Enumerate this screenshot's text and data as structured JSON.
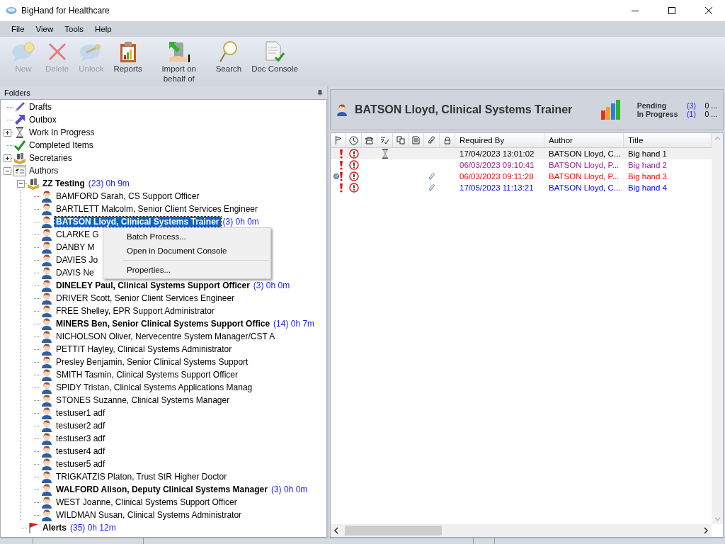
{
  "window": {
    "title": "BigHand for Healthcare"
  },
  "menu": [
    "File",
    "View",
    "Tools",
    "Help"
  ],
  "toolbar": [
    {
      "kind": "new",
      "label": "New",
      "disabled": true
    },
    {
      "kind": "delete",
      "label": "Delete",
      "disabled": true
    },
    {
      "kind": "unlock",
      "label": "Unlock",
      "disabled": true
    },
    {
      "kind": "reports",
      "label": "Reports",
      "disabled": false
    },
    {
      "kind": "import",
      "label": "Import on behalf of",
      "disabled": false
    },
    {
      "kind": "search",
      "label": "Search",
      "disabled": false
    },
    {
      "kind": "console",
      "label": "Doc Console",
      "disabled": false
    }
  ],
  "folders": {
    "title": "Folders",
    "tree": [
      {
        "kind": "pencil",
        "label": "Drafts",
        "selected": false
      },
      {
        "kind": "outbox",
        "label": "Outbox",
        "selected": false
      },
      {
        "kind": "hourglass",
        "label": "Work In Progress",
        "expanded": false,
        "selected": false
      },
      {
        "kind": "check",
        "label": "Completed Items",
        "selected": false
      },
      {
        "kind": "group",
        "label": "Secretaries",
        "expanded": false,
        "selected": false
      },
      {
        "kind": "list",
        "label": "Authors",
        "expanded": true,
        "selected": false,
        "children": [
          {
            "kind": "group",
            "label": "ZZ Testing",
            "bold": true,
            "count": "(23) 0h 9m",
            "expanded": true,
            "selected": false,
            "children": [
              {
                "kind": "person",
                "label": "BAMFORD Sarah, CS Support Officer",
                "bold": false,
                "selected": false
              },
              {
                "kind": "person",
                "label": "BARTLETT Malcolm, Senior Client Services Engineer",
                "bold": false,
                "selected": false
              },
              {
                "kind": "person",
                "label": "BATSON Lloyd, Clinical Systems Trainer",
                "bold": true,
                "count": "(3) 0h 0m",
                "selected": true
              },
              {
                "kind": "person",
                "label": "CLARKE G",
                "bold": false,
                "selected": false
              },
              {
                "kind": "person",
                "label": "DANBY M",
                "bold": false,
                "selected": false
              },
              {
                "kind": "person",
                "label": "DAVIES Jo",
                "bold": false,
                "selected": false
              },
              {
                "kind": "person",
                "label": "DAVIS Ne",
                "bold": false,
                "selected": false
              },
              {
                "kind": "person",
                "label": "DINELEY Paul, Clinical Systems Support Officer",
                "bold": true,
                "count": "(3) 0h 0m",
                "selected": false
              },
              {
                "kind": "person",
                "label": "DRIVER Scott, Senior Client Services Engineer",
                "bold": false,
                "selected": false
              },
              {
                "kind": "person",
                "label": "FREE Shelley, EPR Support Administrator",
                "bold": false,
                "selected": false
              },
              {
                "kind": "person",
                "label": "MINERS Ben, Senior Clinical Systems Support Office",
                "bold": true,
                "count": "(14) 0h 7m",
                "selected": false
              },
              {
                "kind": "person",
                "label": "NICHOLSON Oliver, Nervecentre System Manager/CST A",
                "bold": false,
                "selected": false
              },
              {
                "kind": "person",
                "label": "PETTIT Hayley, Clinical Systems Administrator",
                "bold": false,
                "selected": false
              },
              {
                "kind": "person",
                "label": "Presley Benjamin, Senior Clinical Systems Support",
                "bold": false,
                "selected": false
              },
              {
                "kind": "person",
                "label": "SMITH Tasmin, Clinical Systems Support Officer",
                "bold": false,
                "selected": false
              },
              {
                "kind": "person",
                "label": "SPIDY Tristan, Clinical Systems Applications Manag",
                "bold": false,
                "selected": false
              },
              {
                "kind": "person",
                "label": "STONES Suzanne, Clinical Systems Manager",
                "bold": false,
                "selected": false
              },
              {
                "kind": "person",
                "label": "testuser1 adf",
                "bold": false,
                "selected": false
              },
              {
                "kind": "person",
                "label": "testuser2 adf",
                "bold": false,
                "selected": false
              },
              {
                "kind": "person",
                "label": "testuser3 adf",
                "bold": false,
                "selected": false
              },
              {
                "kind": "person",
                "label": "testuser4 adf",
                "bold": false,
                "selected": false
              },
              {
                "kind": "person",
                "label": "testuser5 adf",
                "bold": false,
                "selected": false
              },
              {
                "kind": "person",
                "label": "TRIGKATZIS Platon, Trust StR Higher Doctor",
                "bold": false,
                "selected": false
              },
              {
                "kind": "person",
                "label": "WALFORD Alison, Deputy Clinical Systems Manager",
                "bold": true,
                "count": "(3) 0h 0m",
                "selected": false
              },
              {
                "kind": "person",
                "label": "WEST Joanne, Clinical Systems Support Officer",
                "bold": false,
                "selected": false
              },
              {
                "kind": "person",
                "label": "WILDMAN Susan, Clinical Systems Administrator",
                "bold": false,
                "selected": false
              }
            ]
          },
          {
            "kind": "flag",
            "label": "Alerts",
            "bold": true,
            "count": "(35) 0h 12m",
            "selected": false
          }
        ]
      }
    ]
  },
  "context_menu": [
    {
      "kind": "item",
      "label": "Batch Process..."
    },
    {
      "kind": "item",
      "label": "Open in Document Console"
    },
    {
      "kind": "separator"
    },
    {
      "kind": "item",
      "label": "Properties..."
    }
  ],
  "author_panel": {
    "name": "BATSON Lloyd, Clinical Systems Trainer",
    "stats": [
      {
        "label": "Pending",
        "count": "(3)",
        "value": "0 ..."
      },
      {
        "label": "In Progress",
        "count": "(1)",
        "value": "0 ..."
      }
    ]
  },
  "table": {
    "columns": [
      "Required By",
      "Author",
      "Title"
    ],
    "rows": [
      {
        "selected": true,
        "color": "#000000",
        "priority": true,
        "overdue": true,
        "gauge": false,
        "hourglass": true,
        "attachment": false,
        "required_by": "17/04/2023 13:01:02",
        "author": "BATSON Lloyd, C...",
        "title": "Big hand 1"
      },
      {
        "selected": false,
        "color": "#9c1a9c",
        "priority": true,
        "overdue": true,
        "gauge": false,
        "hourglass": false,
        "attachment": false,
        "required_by": "06/03/2023 09:10:41",
        "author": "BATSON Lloyd, P...",
        "title": "Big hand 2"
      },
      {
        "selected": false,
        "color": "#ff0000",
        "priority": true,
        "overdue": true,
        "gauge": true,
        "hourglass": false,
        "attachment": true,
        "required_by": "06/03/2023 09:11:28",
        "author": "BATSON Lloyd, P...",
        "title": "Big hand 3"
      },
      {
        "selected": false,
        "color": "#0000ff",
        "priority": true,
        "overdue": true,
        "gauge": false,
        "hourglass": false,
        "attachment": true,
        "required_by": "17/05/2023 11:13:21",
        "author": "BATSON Lloyd, C...",
        "title": "Big hand 4"
      }
    ]
  }
}
